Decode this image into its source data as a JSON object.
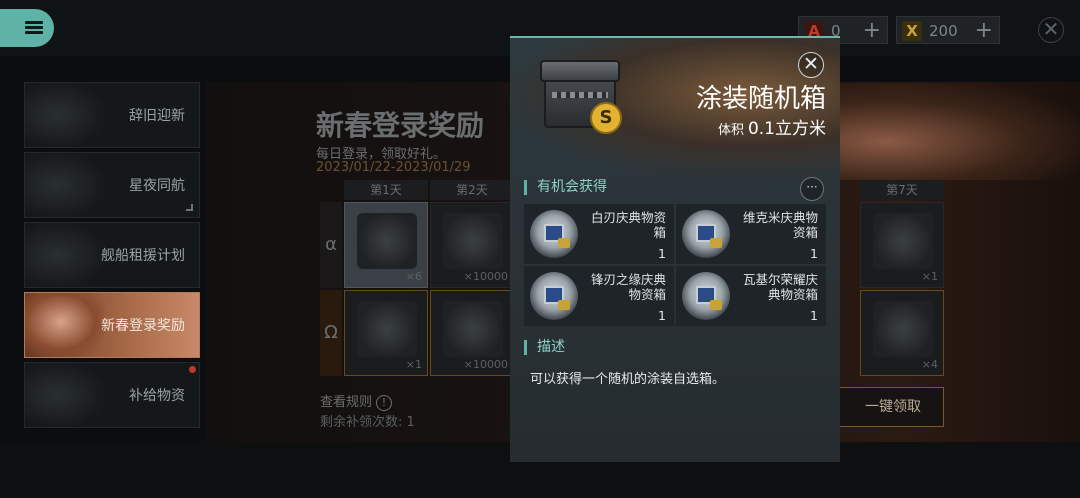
{
  "topbar": {
    "resources": [
      {
        "icon": "alpha-token-icon",
        "symbol": "A",
        "color": "#c0392b",
        "value": "0"
      },
      {
        "icon": "gold-x-token-icon",
        "symbol": "X",
        "color": "#c9a23a",
        "value": "200"
      }
    ],
    "plus": "+",
    "close": "✕"
  },
  "sidebar": {
    "items": [
      {
        "label": "辞旧迎新"
      },
      {
        "label": "星夜同航"
      },
      {
        "label": "舰船租援计划"
      },
      {
        "label": "新春登录奖励",
        "active": true
      },
      {
        "label": "补给物资",
        "badge": true
      }
    ]
  },
  "main": {
    "title": "新春登录奖励",
    "subtitle": "每日登录，领取好礼。",
    "date_range": "2023/01/22-2023/01/29",
    "columns": [
      "第1天",
      "第2天",
      "第7天"
    ],
    "rows": [
      {
        "symbol": "α",
        "cells": [
          {
            "qty": "×6",
            "selected": true
          },
          {
            "qty": "×10000"
          },
          {
            "qty": "×1"
          }
        ]
      },
      {
        "symbol": "Ω",
        "cells": [
          {
            "qty": "×1"
          },
          {
            "qty": "×10000"
          },
          {
            "qty": "×4"
          }
        ]
      }
    ],
    "rules_label": "查看规则",
    "rules_mark": "!",
    "remaining": "剩余补领次数: 1",
    "claim_all": "一键领取"
  },
  "modal": {
    "item_name": "涂装随机箱",
    "volume_label": "体积",
    "volume_value": "0.1立方米",
    "badge_symbol": "S",
    "close": "✕",
    "drops_title": "有机会获得",
    "more": "···",
    "drops": [
      {
        "name": "白刃庆典物资箱",
        "count": "1"
      },
      {
        "name": "维克米庆典物资箱",
        "count": "1"
      },
      {
        "name": "锋刃之缘庆典物资箱",
        "count": "1"
      },
      {
        "name": "瓦基尔荣耀庆典物资箱",
        "count": "1"
      }
    ],
    "desc_title": "描述",
    "desc_text": "可以获得一个随机的涂装自选箱。"
  }
}
